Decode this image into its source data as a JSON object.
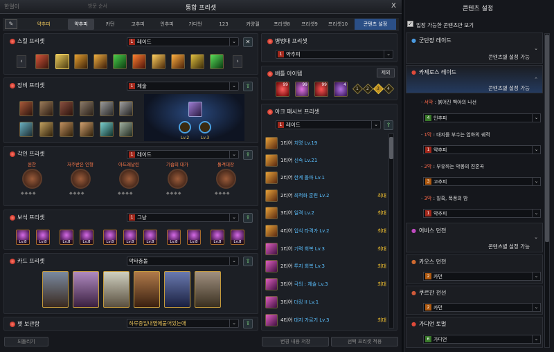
{
  "window": {
    "title": "통합 프리셋",
    "close": "X",
    "bg_left": "한얼이",
    "bg_sub": "방문 순서"
  },
  "tabs": [
    "약추피",
    "약추피",
    "카던",
    "고추피",
    "인추피",
    "가디언",
    "123",
    "카양겔",
    "프리셋8",
    "프리셋9",
    "프리셋10",
    "콘텐츠 설정"
  ],
  "skill": {
    "title": "스킬 프리셋",
    "preset": "레이드",
    "preset_num": "1"
  },
  "equip": {
    "title": "장비 프리셋",
    "preset": "체술",
    "preset_num": "1",
    "ring_labels": [
      "Lv.2",
      "Lv.3"
    ]
  },
  "engrave": {
    "title": "각인 프리셋",
    "preset": "레이드",
    "preset_num": "1",
    "items": [
      "원한",
      "저주받은 인형",
      "아드레날린",
      "기습의 대가",
      "돌격대장"
    ]
  },
  "gem": {
    "title": "보석 프리셋",
    "preset": "그냥",
    "preset_num": "1",
    "levels": [
      "Lv.8",
      "Lv.8",
      "Lv.8",
      "Lv.8",
      "Lv.8",
      "Lv.8",
      "Lv.8",
      "Lv.8",
      "Lv.8",
      "Lv.8",
      "Lv.8"
    ]
  },
  "card": {
    "title": "카드 프리셋",
    "preset": "악타충돌"
  },
  "pet": {
    "title": "펫 보관함",
    "preset": "하루종일내옆에붙어있는애"
  },
  "footer": {
    "reset": "되돌리기",
    "save": "변경 내용 저장",
    "apply": "선택 프리셋 적용"
  },
  "squad": {
    "title": "병법대 프리셋",
    "preset": "약추피",
    "preset_num": "1"
  },
  "battle": {
    "title": "배틀 아이템",
    "exclude": "제외",
    "counts": [
      "99",
      "99",
      "99",
      "4"
    ],
    "slots": [
      "1",
      "2",
      "3",
      "4"
    ]
  },
  "ark": {
    "title": "아크 패시브 프리셋",
    "preset": "레이드",
    "preset_num": "1",
    "rows": [
      {
        "tier": "1티어",
        "skill": "치명 Lv.19",
        "max": ""
      },
      {
        "tier": "1티어",
        "skill": "신속 Lv.21",
        "max": ""
      },
      {
        "tier": "2티어",
        "skill": "한계 돌파 Lv.1",
        "max": ""
      },
      {
        "tier": "2티어",
        "skill": "최적화 훈련 Lv.2",
        "max": "최대"
      },
      {
        "tier": "3티어",
        "skill": "일격 Lv.2",
        "max": "최대"
      },
      {
        "tier": "4티어",
        "skill": "입식 타격가 Lv.2",
        "max": "최대"
      },
      {
        "tier": "1티어",
        "skill": "기력 회복 Lv.3",
        "max": "최대"
      },
      {
        "tier": "2티어",
        "skill": "투지 회복 Lv.3",
        "max": "최대"
      },
      {
        "tier": "3티어",
        "skill": "극의 : 체술 Lv.3",
        "max": "최대"
      },
      {
        "tier": "3티어",
        "skill": "더킹 II Lv.1",
        "max": ""
      },
      {
        "tier": "4티어",
        "skill": "대지 가르기 Lv.3",
        "max": "최대"
      }
    ]
  },
  "content": {
    "title": "콘텐츠 설정",
    "checkbox": "입장 가능한 콘텐츠만 보기",
    "legion": {
      "title": "군단장 레이드",
      "sub": "콘텐츠별 설정 가능"
    },
    "kazeros": {
      "title": "카제로스 레이드",
      "sub": "콘텐츠별 설정 가능",
      "stages": [
        {
          "prefix": "서막",
          "name": "붉어진 백야의 나선",
          "preset": "인추피",
          "num": "4",
          "color": "#3a7a2a"
        },
        {
          "prefix": "1막",
          "name": "대지를 부수는 업화의 궤적",
          "preset": "약추피",
          "num": "1",
          "color": "#a3281c"
        },
        {
          "prefix": "2막",
          "name": "부유하는 악몽의 진혼곡",
          "preset": "고추피",
          "num": "3",
          "color": "#b05a10"
        },
        {
          "prefix": "3막",
          "name": "칠흑, 폭풍의 밤",
          "preset": "약추피",
          "num": "1",
          "color": "#a3281c"
        }
      ]
    },
    "abyss": {
      "title": "어비스 던전",
      "sub": "콘텐츠별 설정 가능"
    },
    "chaos": {
      "title": "카오스 던전",
      "preset": "카던",
      "num": "2"
    },
    "kurzan": {
      "title": "쿠르잔 전선",
      "preset": "카던",
      "num": "2"
    },
    "guardian": {
      "title": "가디언 토벌",
      "preset": "가디언",
      "num": "6"
    }
  },
  "colors": {
    "accent": "#3a6fc0",
    "gold": "#ffcb30",
    "red": "#a3281c"
  }
}
